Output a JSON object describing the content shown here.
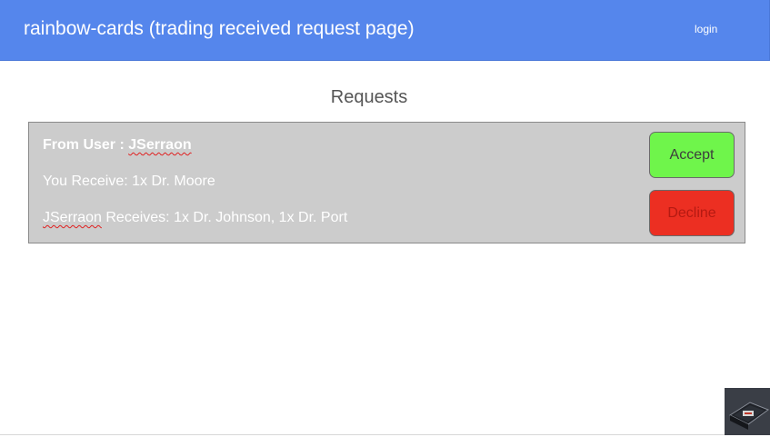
{
  "header": {
    "app_title": "rainbow-cards (trading received request page)",
    "login_label": "login"
  },
  "main": {
    "section_title": "Requests",
    "requests": [
      {
        "from_prefix": "From User : ",
        "from_user": "JSerraon",
        "receive_text": "You Receive: 1x Dr. Moore",
        "give_user": "JSerraon",
        "give_text": " Receives: 1x Dr. Johnson, 1x Dr. Port",
        "accept_label": "Accept",
        "decline_label": "Decline"
      }
    ]
  },
  "colors": {
    "header": "#5586ec",
    "card": "#cccccc",
    "accept": "#6ff54b",
    "decline": "#ec2f22"
  },
  "icons": {
    "corner_thumbnail": "app-thumbnail-icon"
  }
}
